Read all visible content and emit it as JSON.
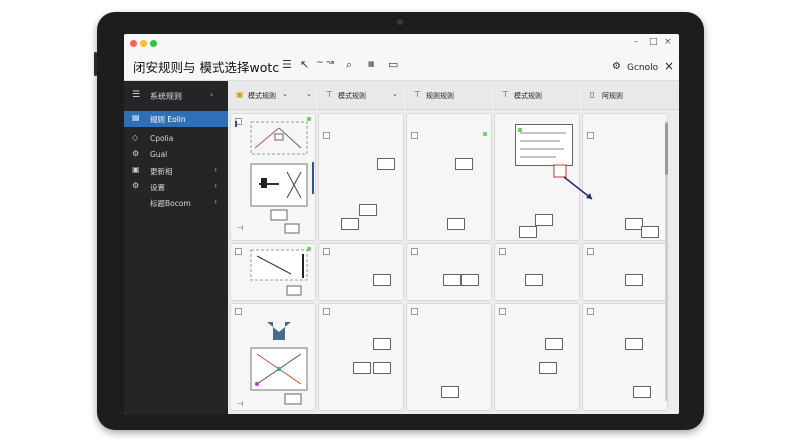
{
  "window": {
    "title": "闭安规则与 模式选择wotc",
    "controls": [
      "–",
      "□",
      "×"
    ],
    "account_label": "Gcnolo"
  },
  "toolbar": {
    "icons": [
      "text-align-icon",
      "lasso-icon",
      "connector-icon",
      "search-icon",
      "grid-icon",
      "comment-icon"
    ]
  },
  "sidebar": {
    "header": "系统规则",
    "items": [
      {
        "label": "规则 Eolin",
        "icon": "file-icon",
        "active": true,
        "chevron": false
      },
      {
        "label": "Cpolia",
        "icon": "diamond-icon",
        "active": false,
        "chevron": false
      },
      {
        "label": "Gual",
        "icon": "gear-icon",
        "active": false,
        "chevron": false
      },
      {
        "label": "更新相",
        "icon": "image-icon",
        "active": false,
        "chevron": true
      },
      {
        "label": "设置",
        "icon": "settings-icon",
        "active": false,
        "chevron": true
      },
      {
        "label": "标题Bocom",
        "icon": "none",
        "active": false,
        "chevron": true
      }
    ]
  },
  "columns": [
    {
      "label": "模式规则",
      "icon": "doc-icon",
      "dropdown": true
    },
    {
      "label": "模式规则",
      "icon": "layout-icon",
      "dropdown": true
    },
    {
      "label": "规则规则",
      "icon": "layout-icon",
      "dropdown": false
    },
    {
      "label": "模式规则",
      "icon": "layout-icon",
      "dropdown": false
    },
    {
      "label": "阿规则",
      "icon": "page-icon",
      "dropdown": false
    }
  ],
  "colors": {
    "accent": "#2f6fb7",
    "sidebar_bg": "#252527",
    "traffic_red": "#ff5f57",
    "traffic_yellow": "#febc2e",
    "traffic_green": "#28c840"
  }
}
